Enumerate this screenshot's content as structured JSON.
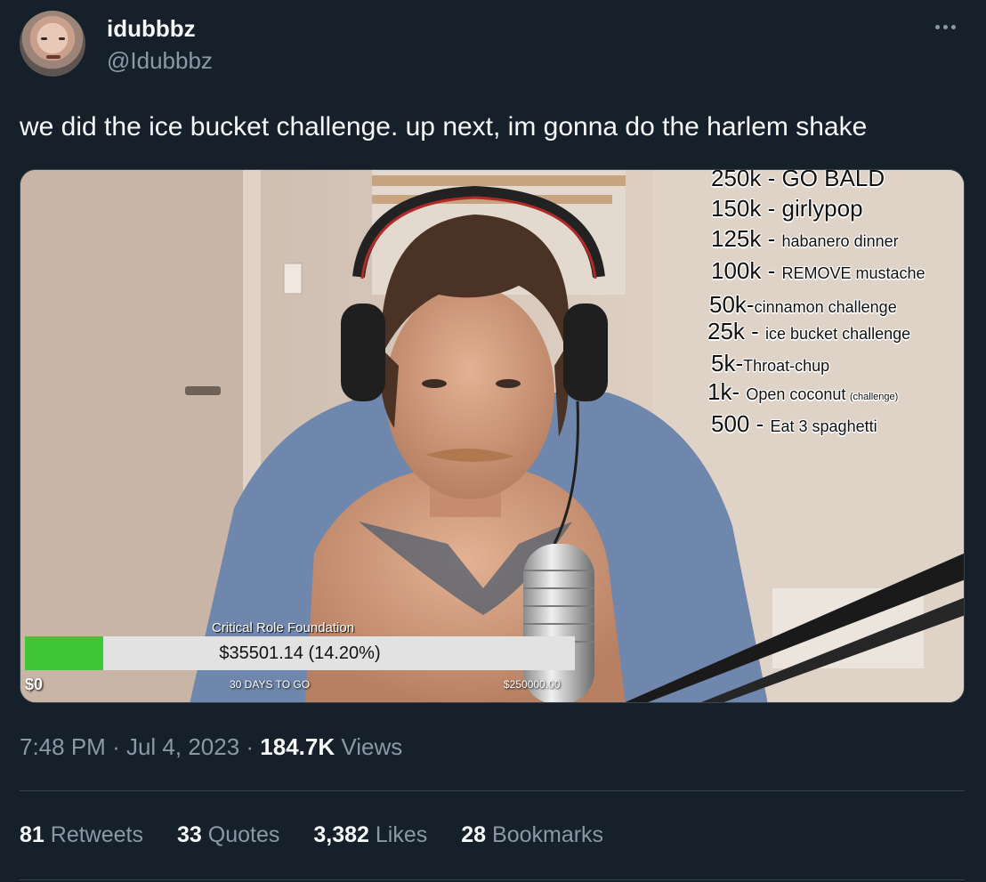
{
  "author": {
    "display_name": "idubbbz",
    "handle": "@Idubbbz"
  },
  "tweet": {
    "text": "we did the ice bucket challenge. up next, im gonna do the harlem shake",
    "time": "7:48 PM",
    "date": "Jul 4, 2023",
    "views_count": "184.7K",
    "views_label": "Views"
  },
  "media": {
    "goals": [
      {
        "amount": "250k",
        "label": "GO BALD",
        "note": ""
      },
      {
        "amount": "150k",
        "label": "girlypop",
        "note": ""
      },
      {
        "amount": "125k",
        "label": "habanero dinner",
        "note": ""
      },
      {
        "amount": "100k",
        "label": "REMOVE mustache",
        "note": ""
      },
      {
        "amount": "50k",
        "label": "cinnamon challenge",
        "note": ""
      },
      {
        "amount": "25k",
        "label": "ice bucket challenge",
        "note": ""
      },
      {
        "amount": "5k",
        "label": "Throat-chup",
        "note": ""
      },
      {
        "amount": "1k",
        "label": "Open coconut",
        "note": "(challenge)"
      },
      {
        "amount": "500",
        "label": "Eat 3 spaghetti",
        "note": ""
      }
    ],
    "donation": {
      "title": "Critical Role Foundation",
      "amount_text": "$35501.14 (14.20%)",
      "progress_fraction": 0.142,
      "start_label": "$0",
      "days_label": "30 DAYS TO GO",
      "goal_label": "$250000.00"
    }
  },
  "stats": {
    "retweets_count": "81",
    "retweets_label": "Retweets",
    "quotes_count": "33",
    "quotes_label": "Quotes",
    "likes_count": "3,382",
    "likes_label": "Likes",
    "bookmarks_count": "28",
    "bookmarks_label": "Bookmarks"
  },
  "colors": {
    "background": "#15202b",
    "secondary_text": "#8b98a5",
    "progress_fill": "#3ec637"
  }
}
